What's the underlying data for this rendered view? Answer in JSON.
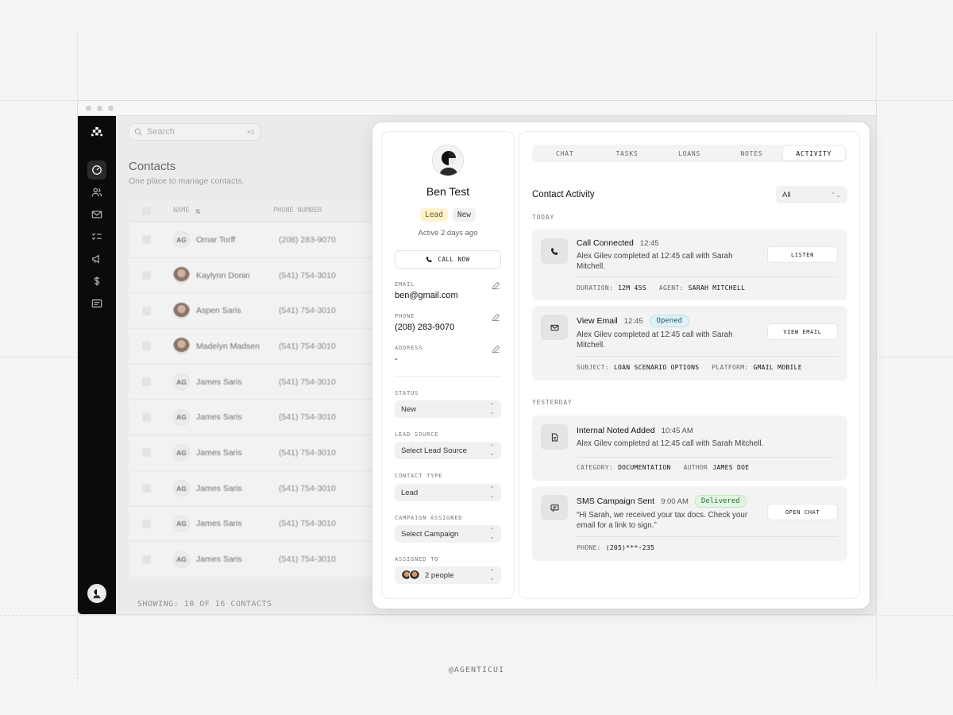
{
  "search": {
    "placeholder": "Search",
    "shortcut": "⌘S"
  },
  "page": {
    "title": "Contacts",
    "subtitle": "One place to manage contacts."
  },
  "table": {
    "columns": {
      "name": "NAME",
      "phone": "PHONE NUMBER"
    },
    "rows": [
      {
        "initials": "AG",
        "name": "Omar Torff",
        "phone": "(208) 283-9070",
        "photo": false
      },
      {
        "initials": "",
        "name": "Kaylynn Donin",
        "phone": "(541) 754-3010",
        "photo": true
      },
      {
        "initials": "",
        "name": "Aspen Saris",
        "phone": "(541) 754-3010",
        "photo": true
      },
      {
        "initials": "",
        "name": "Madelyn Madsen",
        "phone": "(541) 754-3010",
        "photo": true
      },
      {
        "initials": "AG",
        "name": "James Saris",
        "phone": "(541) 754-3010",
        "photo": false
      },
      {
        "initials": "AG",
        "name": "James Saris",
        "phone": "(541) 754-3010",
        "photo": false
      },
      {
        "initials": "AG",
        "name": "James Saris",
        "phone": "(541) 754-3010",
        "photo": false
      },
      {
        "initials": "AG",
        "name": "James Saris",
        "phone": "(541) 754-3010",
        "photo": false
      },
      {
        "initials": "AG",
        "name": "James Saris",
        "phone": "(541) 754-3010",
        "photo": false
      },
      {
        "initials": "AG",
        "name": "James Saris",
        "phone": "(541) 754-3010",
        "photo": false
      }
    ],
    "showing": "SHOWING: 10 OF 16 CONTACTS"
  },
  "contact": {
    "name": "Ben Test",
    "chips": {
      "type": "Lead",
      "status": "New"
    },
    "active": "Active 2 days ago",
    "call_button": "CALL NOW",
    "email_label": "EMAIL",
    "email": "ben@gmail.com",
    "phone_label": "PHONE",
    "phone": "(208) 283-9070",
    "address_label": "ADDRESS",
    "address": "-",
    "status_label": "STATUS",
    "status_value": "New",
    "lead_source_label": "LEAD SOURCE",
    "lead_source_value": "Select Lead Source",
    "contact_type_label": "CONTACT TYPE",
    "contact_type_value": "Lead",
    "campaign_label": "CAMPAIGN ASSIGNED",
    "campaign_value": "Select Campaign",
    "assigned_label": "ASSIGNED TO",
    "assigned_value": "2 people"
  },
  "tabs": [
    "CHAT",
    "TASKS",
    "LOANS",
    "NOTES",
    "ACTIVITY"
  ],
  "activity": {
    "title": "Contact Activity",
    "filter": "All",
    "today_label": "TODAY",
    "yesterday_label": "YESTERDAY",
    "items": [
      {
        "title": "Call Connected",
        "time": "12:45",
        "desc": "Alex Gilev completed at 12:45 call with Sarah Mitchell.",
        "meta1_label": "DURATION:",
        "meta1_value": "12M 45S",
        "meta2_label": "AGENT:",
        "meta2_value": "SARAH MITCHELL",
        "button": "LISTEN",
        "icon": "phone-icon"
      },
      {
        "title": "View Email",
        "time": "12:45",
        "badge": "Opened",
        "desc": "Alex Gilev completed at 12:45 call with Sarah Mitchell.",
        "meta1_label": "SUBJECT:",
        "meta1_value": "LOAN SCENARIO OPTIONS",
        "meta2_label": "PLATFORM:",
        "meta2_value": "GMAIL MOBILE",
        "button": "VIEW EMAIL",
        "icon": "mail-icon"
      },
      {
        "title": "Internal Noted Added",
        "time": "10:45 AM",
        "desc": "Alex Gilev completed at 12:45 call with Sarah Mitchell.",
        "meta1_label": "CATEGORY:",
        "meta1_value": "DOCUMENTATION",
        "meta2_label": "AUTHOR",
        "meta2_value": "JAMES DOE",
        "icon": "document-icon"
      },
      {
        "title": "SMS Campaign Sent",
        "time": "9:00 AM",
        "badge": "Delivered",
        "desc": "“Hi Sarah, we received your tax docs. Check your email for a link to sign.”",
        "meta1_label": "PHONE:",
        "meta1_value": "(205)***-235",
        "button": "OPEN CHAT",
        "icon": "message-icon"
      }
    ]
  },
  "footer": "@AGENTICUI",
  "colors": {
    "sidebar": "#0b0b0b",
    "lead_chip": "#fdf4cf",
    "opened_badge": "#dff2f5",
    "delivered_badge": "#e2f5e3"
  }
}
